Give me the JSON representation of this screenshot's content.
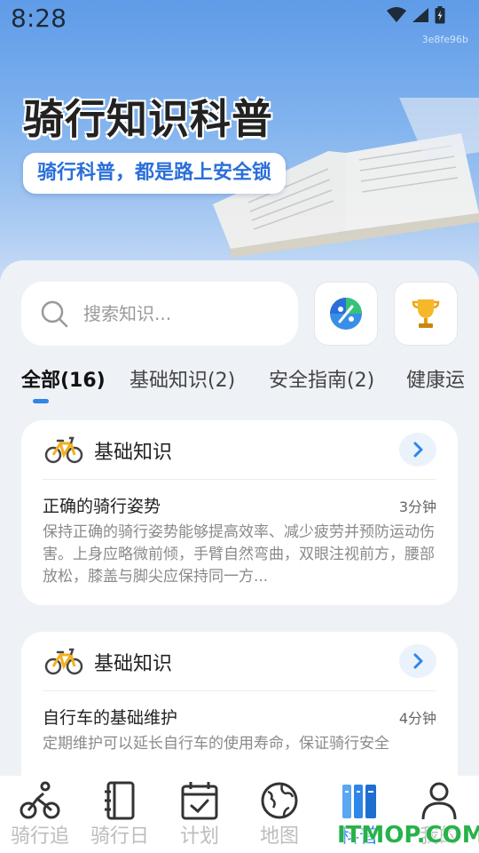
{
  "status_bar": {
    "time": "8:28",
    "device_id": "3e8fe96b"
  },
  "hero": {
    "title": "骑行知识科普",
    "subtitle": "骑行科普，都是路上安全锁"
  },
  "search": {
    "placeholder": "搜索知识..."
  },
  "quick_buttons": [
    {
      "icon": "discount-badge-icon"
    },
    {
      "icon": "trophy-icon"
    }
  ],
  "tabs": [
    {
      "label": "全部(16)",
      "active": true
    },
    {
      "label": "基础知识(2)",
      "active": false
    },
    {
      "label": "安全指南(2)",
      "active": false
    },
    {
      "label": "健康运",
      "active": false
    }
  ],
  "articles": [
    {
      "category": "基础知识",
      "title": "正确的骑行姿势",
      "read_time": "3分钟",
      "summary": "保持正确的骑行姿势能够提高效率、减少疲劳并预防运动伤害。上身应略微前倾，手臂自然弯曲，双眼注视前方，腰部放松，膝盖与脚尖应保持同一方..."
    },
    {
      "category": "基础知识",
      "title": "自行车的基础维护",
      "read_time": "4分钟",
      "summary": "定期维护可以延长自行车的使用寿命，保证骑行安全"
    }
  ],
  "bottom_nav": [
    {
      "label": "骑行追",
      "icon": "cyclist-icon",
      "active": false
    },
    {
      "label": "骑行日",
      "icon": "journal-icon",
      "active": false
    },
    {
      "label": "计划",
      "icon": "calendar-check-icon",
      "active": false
    },
    {
      "label": "地图",
      "icon": "globe-icon",
      "active": false
    },
    {
      "label": "科普",
      "icon": "books-icon",
      "active": true
    },
    {
      "label": "我的",
      "icon": "person-icon",
      "active": false
    }
  ],
  "watermark": {
    "text": "ITMOP.COM"
  },
  "colors": {
    "accent": "#2f86e9",
    "hero_top": "#5f9be8",
    "panel": "#eef2f6",
    "watermark": "#27b24a"
  }
}
